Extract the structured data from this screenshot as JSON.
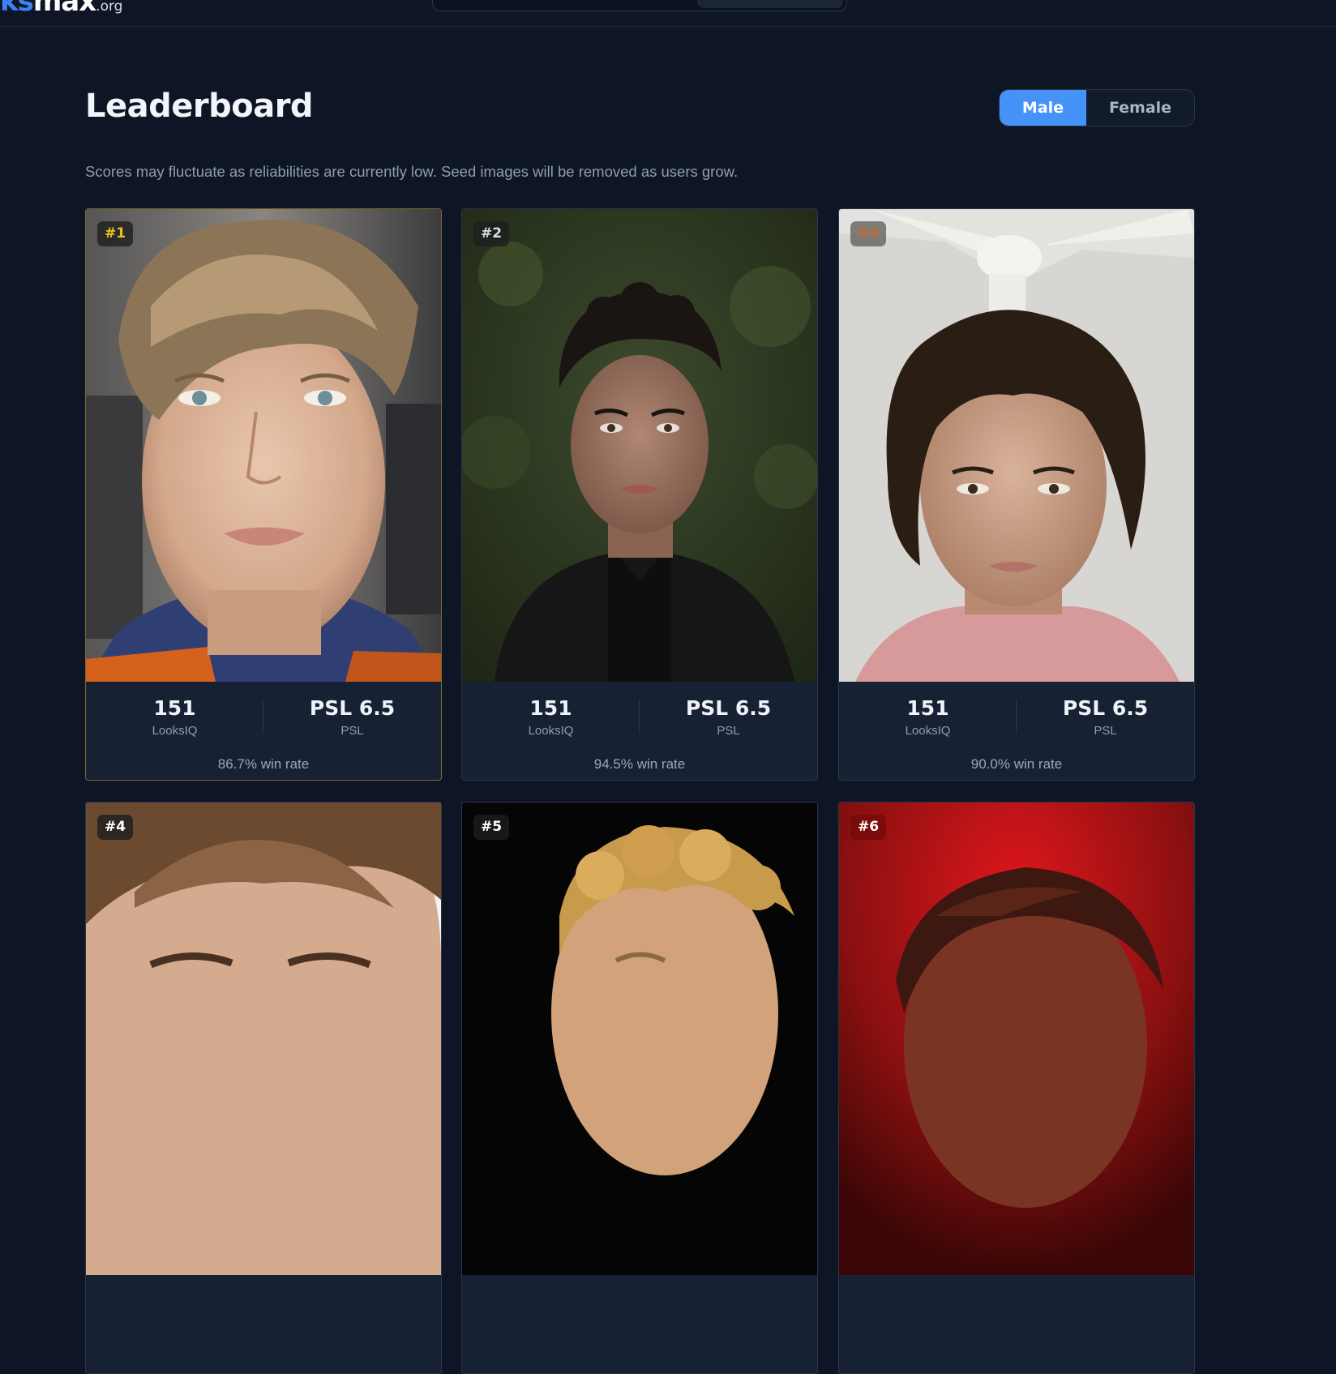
{
  "nav": {
    "logo_accent": "ks",
    "logo_main": "max",
    "logo_tld": ".org"
  },
  "header": {
    "title": "Leaderboard",
    "toggle": {
      "male_label": "Male",
      "female_label": "Female",
      "selected": "Male"
    },
    "notice": "Scores may fluctuate as reliabilities are currently low. Seed images will be removed as users grow."
  },
  "colors": {
    "accent": "#4592f8",
    "gold": "#f0c419",
    "silver": "#d9dde3",
    "bronze": "#c86a2b",
    "background": "#0e1626",
    "card": "#172134"
  },
  "entries": [
    {
      "rank": "#1",
      "score": "151",
      "score_label": "LooksIQ",
      "psl": "PSL 6.5",
      "psl_label": "PSL",
      "win_rate": "86.7% win rate"
    },
    {
      "rank": "#2",
      "score": "151",
      "score_label": "LooksIQ",
      "psl": "PSL 6.5",
      "psl_label": "PSL",
      "win_rate": "94.5% win rate"
    },
    {
      "rank": "#3",
      "score": "151",
      "score_label": "LooksIQ",
      "psl": "PSL 6.5",
      "psl_label": "PSL",
      "win_rate": "90.0% win rate"
    },
    {
      "rank": "#4"
    },
    {
      "rank": "#5"
    },
    {
      "rank": "#6"
    }
  ]
}
